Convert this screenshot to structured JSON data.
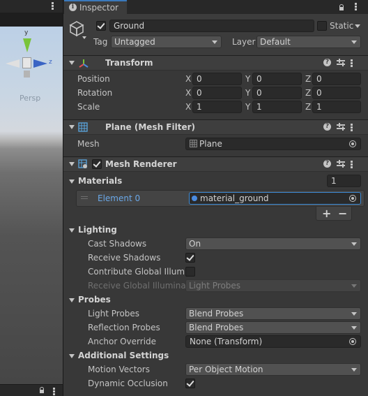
{
  "scene": {
    "gizmo_y": "y",
    "gizmo_z": "z",
    "projection": "Persp"
  },
  "inspector": {
    "tab_title": "Inspector",
    "object_name": "Ground",
    "active": true,
    "static_label": "Static",
    "static_checked": false,
    "tag_label": "Tag",
    "tag_value": "Untagged",
    "layer_label": "Layer",
    "layer_value": "Default"
  },
  "transform": {
    "title": "Transform",
    "position_label": "Position",
    "rotation_label": "Rotation",
    "scale_label": "Scale",
    "axis_x": "X",
    "axis_y": "Y",
    "axis_z": "Z",
    "position": [
      "0",
      "0",
      "0"
    ],
    "rotation": [
      "0",
      "0",
      "0"
    ],
    "scale": [
      "1",
      "1",
      "1"
    ]
  },
  "mesh_filter": {
    "title": "Plane (Mesh Filter)",
    "mesh_label": "Mesh",
    "mesh_value": "Plane"
  },
  "mesh_renderer": {
    "title": "Mesh Renderer",
    "enabled": true,
    "materials_label": "Materials",
    "materials_count": "1",
    "element_label": "Element 0",
    "element_value": "material_ground",
    "plus": "+",
    "minus": "−",
    "lighting": {
      "label": "Lighting",
      "cast_shadows_label": "Cast Shadows",
      "cast_shadows_value": "On",
      "receive_shadows_label": "Receive Shadows",
      "receive_shadows": true,
      "contribute_gi_label": "Contribute Global Illumin",
      "contribute_gi": false,
      "receive_gi_label": "Receive Global Illuminati",
      "receive_gi_value": "Light Probes"
    },
    "probes": {
      "label": "Probes",
      "light_probes_label": "Light Probes",
      "light_probes_value": "Blend Probes",
      "reflection_probes_label": "Reflection Probes",
      "reflection_probes_value": "Blend Probes",
      "anchor_override_label": "Anchor Override",
      "anchor_override_value": "None (Transform)"
    },
    "additional": {
      "label": "Additional Settings",
      "motion_vectors_label": "Motion Vectors",
      "motion_vectors_value": "Per Object Motion",
      "dynamic_occlusion_label": "Dynamic Occlusion",
      "dynamic_occlusion": true
    }
  },
  "colors": {
    "accent": "#3a79bb",
    "element_label": "#6aa8e8",
    "panel_bg": "#383838"
  }
}
